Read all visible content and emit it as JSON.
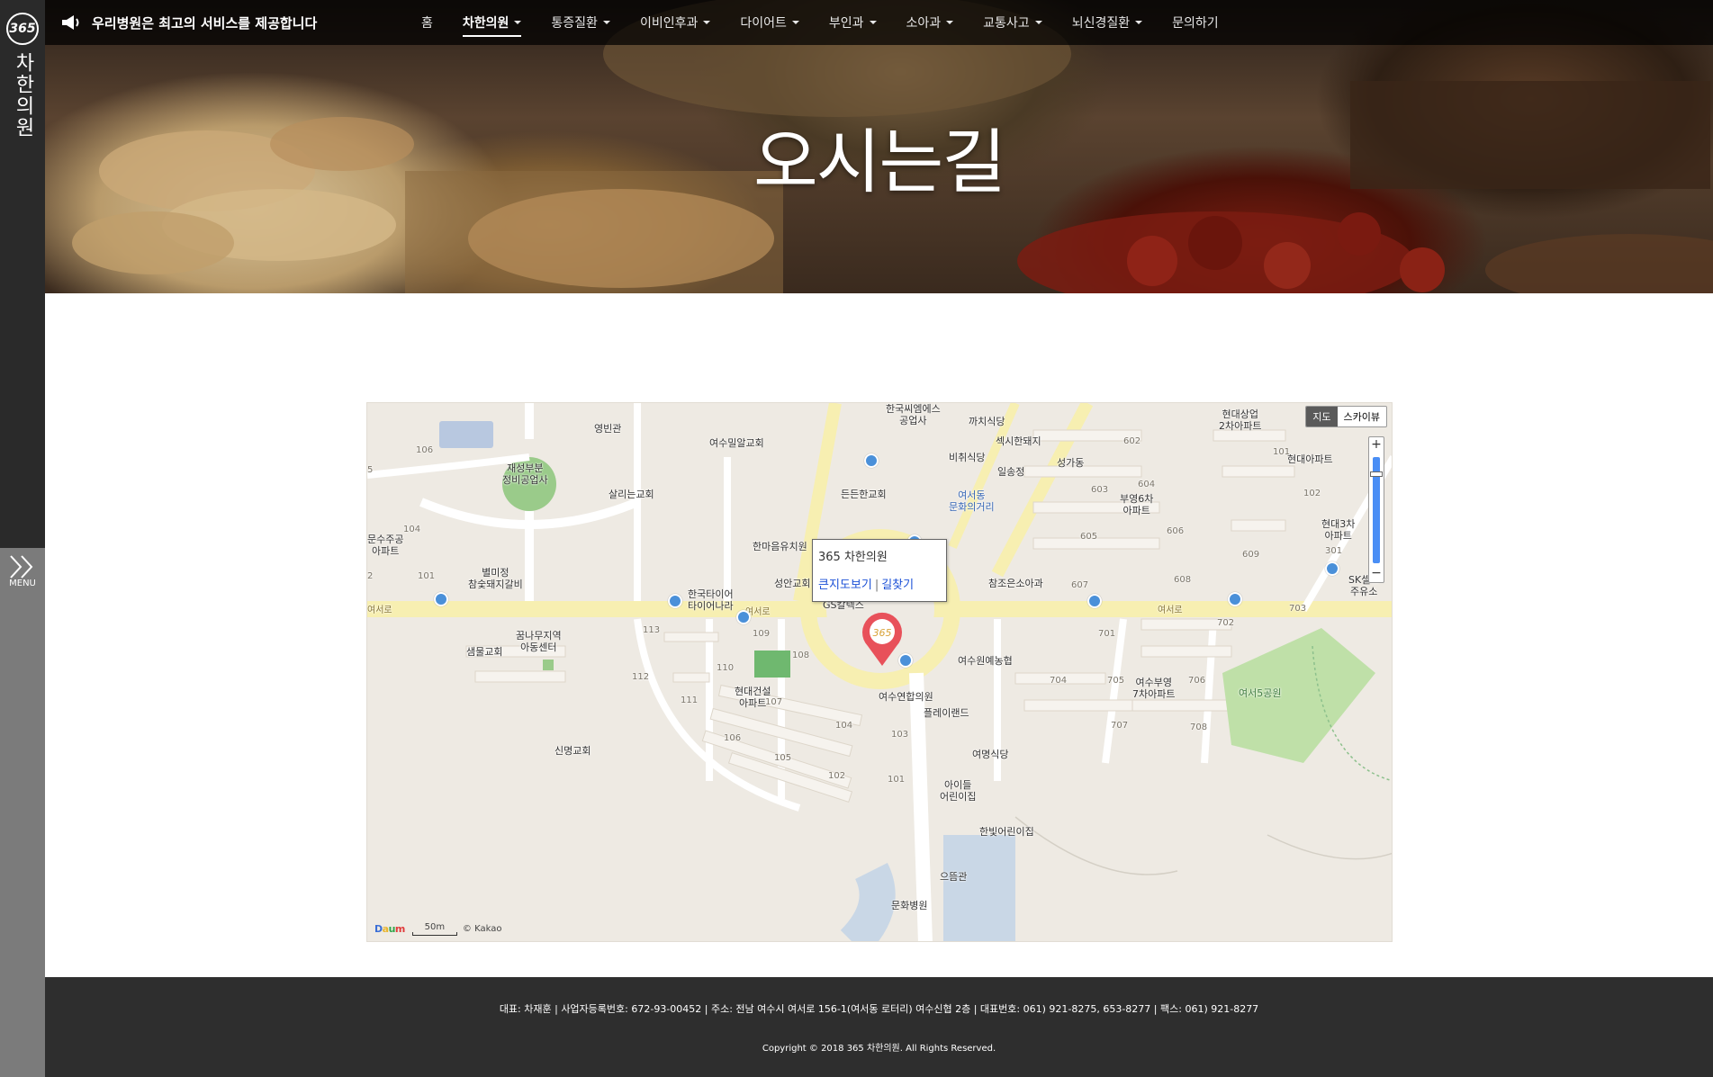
{
  "brand": {
    "logo_number": "365",
    "logo_name": "차한의원"
  },
  "rail": {
    "menu_label": "MENU"
  },
  "topbar": {
    "notice": "우리병원은 최고의 서비스를 제공합니다"
  },
  "nav": {
    "items": [
      {
        "label": "홈",
        "dropdown": false
      },
      {
        "label": "차한의원",
        "dropdown": true,
        "active": true
      },
      {
        "label": "통증질환",
        "dropdown": true
      },
      {
        "label": "이비인후과",
        "dropdown": true
      },
      {
        "label": "다이어트",
        "dropdown": true
      },
      {
        "label": "부인과",
        "dropdown": true
      },
      {
        "label": "소아과",
        "dropdown": true
      },
      {
        "label": "교통사고",
        "dropdown": true
      },
      {
        "label": "뇌신경질환",
        "dropdown": true
      },
      {
        "label": "문의하기",
        "dropdown": false
      }
    ]
  },
  "hero": {
    "title": "오시는길"
  },
  "map": {
    "type_buttons": [
      "지도",
      "스카이뷰"
    ],
    "zoom_in": "+",
    "zoom_out": "−",
    "infowindow": {
      "title": "365 차한의원",
      "link_large_map": "큰지도보기",
      "separator": "|",
      "link_directions": "길찾기"
    },
    "marker_text": "365",
    "labels": {
      "youngbingwan": "영빈관",
      "yeosu_milal": "여수밀알교회",
      "jaeseong": "재성부분\n정비공업사",
      "salline": "살리는교회",
      "deunden": "든든한교회",
      "hanmaum": "한마음유치원",
      "byeolmijeong": "별미정\n참숯돼지갈비",
      "seongan": "성안교회",
      "hankook_tire": "한국타이어\n타이어나라",
      "gs_caltex": "GS칼텍스",
      "munsu_apt": "문수주공\n아파트",
      "ggumnamu": "꿈나무지역\n아동센터",
      "saemmul": "샘물교회",
      "hyundai_apt": "현대건설\n아파트",
      "sinmyeong": "신명교회",
      "yeosu_yeonhap": "여수연합의원",
      "playland": "플레이랜드",
      "yeomyeong": "여명식당",
      "aideul": "아이들\n어린이집",
      "hanbit": "한빛어린이집",
      "eumgwan": "으뜸관",
      "munhwa_hospital": "문화병원",
      "yeosu_won": "여수원예농협",
      "chamjoeun": "참조은소아과",
      "bueong6": "부영6차\n아파트",
      "bueong7": "여수부영\n7차아파트",
      "yeoseo5_park": "여서5공원",
      "sk_self": "SK셀프\n주유소",
      "hyundai_apt2": "현대아파트",
      "hyundai3": "현대3차\n아파트",
      "hyundai_sangeop": "현대상업\n2차아파트",
      "seonggadong": "성가동",
      "ilsongjeong": "일송정",
      "saeksi": "섹시한돼지",
      "bichu": "비취식당",
      "kkachi": "까치식당",
      "yeoseodong_culture": "여서동\n문화의거리",
      "hanguk_top": "한국씨엠에스\n공업사",
      "yeoseo_road_1": "여서로",
      "yeoseo_road_2": "여서로",
      "yeoseo_road_3": "여서로",
      "b106a": "106",
      "b104a": "104",
      "b101a": "101",
      "b113": "113",
      "b112": "112",
      "b111": "111",
      "b110": "110",
      "b109": "109",
      "b108": "108",
      "b107": "107",
      "b106b": "106",
      "b105": "105",
      "b104b": "104",
      "b103": "103",
      "b102": "102",
      "b101b": "101",
      "b602": "602",
      "b603": "603",
      "b604": "604",
      "b605": "605",
      "b606": "606",
      "b607": "607",
      "b608": "608",
      "b609": "609",
      "b701": "701",
      "b702": "702",
      "b703": "703",
      "b704": "704",
      "b705": "705",
      "b706": "706",
      "b707": "707",
      "b708": "708",
      "b301": "301",
      "b101c": "101",
      "b102c": "102",
      "b5": "5",
      "b2": "2"
    },
    "attribution": {
      "logo": [
        "D",
        "a",
        "u",
        "m"
      ],
      "scale": "50m",
      "copyright": "© Kakao"
    }
  },
  "footer": {
    "info": "대표: 차재훈  |  사업자등록번호: 672-93-00452  |  주소: 전남 여수시 여서로 156-1(여서동 로터리) 여수신협 2층  |  대표번호: 061) 921-8275, 653-8277  |  팩스: 061) 921-8277",
    "copyright": "Copyright © 2018 365 차한의원. All Rights Reserved."
  },
  "colors": {
    "rail": "#2a2a2a",
    "rail_lower": "#7b7b7b",
    "footer": "#2e2e2e",
    "marker": "#e8515a",
    "link": "#1a4fd6"
  }
}
